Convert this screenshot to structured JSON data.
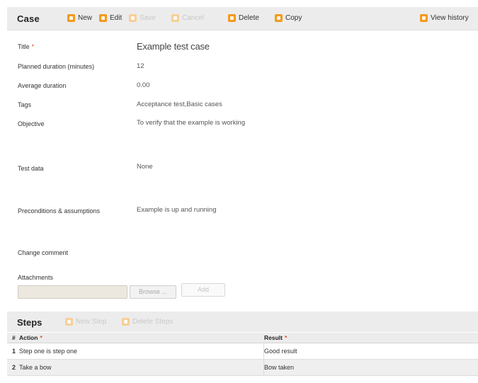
{
  "toolbar": {
    "title": "Case",
    "buttons": {
      "new": "New",
      "edit": "Edit",
      "save": "Save",
      "cancel": "Cancel",
      "delete": "Delete",
      "copy": "Copy",
      "view_history": "View history"
    }
  },
  "fields": {
    "title": {
      "label": "Title",
      "required_mark": "*",
      "value": "Example test case"
    },
    "planned_duration": {
      "label": "Planned duration (minutes)",
      "value": "12"
    },
    "average_duration": {
      "label": "Average duration",
      "value": "0.00"
    },
    "tags": {
      "label": "Tags",
      "value": "Acceptance test,Basic cases"
    },
    "objective": {
      "label": "Objective",
      "value": "To verify that the example is working"
    },
    "test_data": {
      "label": "Test data",
      "value": "None"
    },
    "preconditions": {
      "label": "Preconditions & assumptions",
      "value": "Example is up and running"
    },
    "change_comment": {
      "label": "Change comment"
    },
    "attachments": {
      "label": "Attachments",
      "browse": "Browse ...",
      "add": "Add"
    }
  },
  "steps": {
    "title": "Steps",
    "new_step": "New Step",
    "delete_steps": "Delete Steps",
    "columns": {
      "num": "#",
      "action": "Action",
      "action_req": "*",
      "result": "Result",
      "result_req": "*"
    },
    "rows": [
      {
        "num": "1",
        "action": "Step one is step one",
        "result": "Good result"
      },
      {
        "num": "2",
        "action": "Take a bow",
        "result": "Bow taken"
      }
    ]
  },
  "colors": {
    "accent": "#f39b1b",
    "toolbar_bg": "#ececec",
    "required": "#e14b2b"
  }
}
